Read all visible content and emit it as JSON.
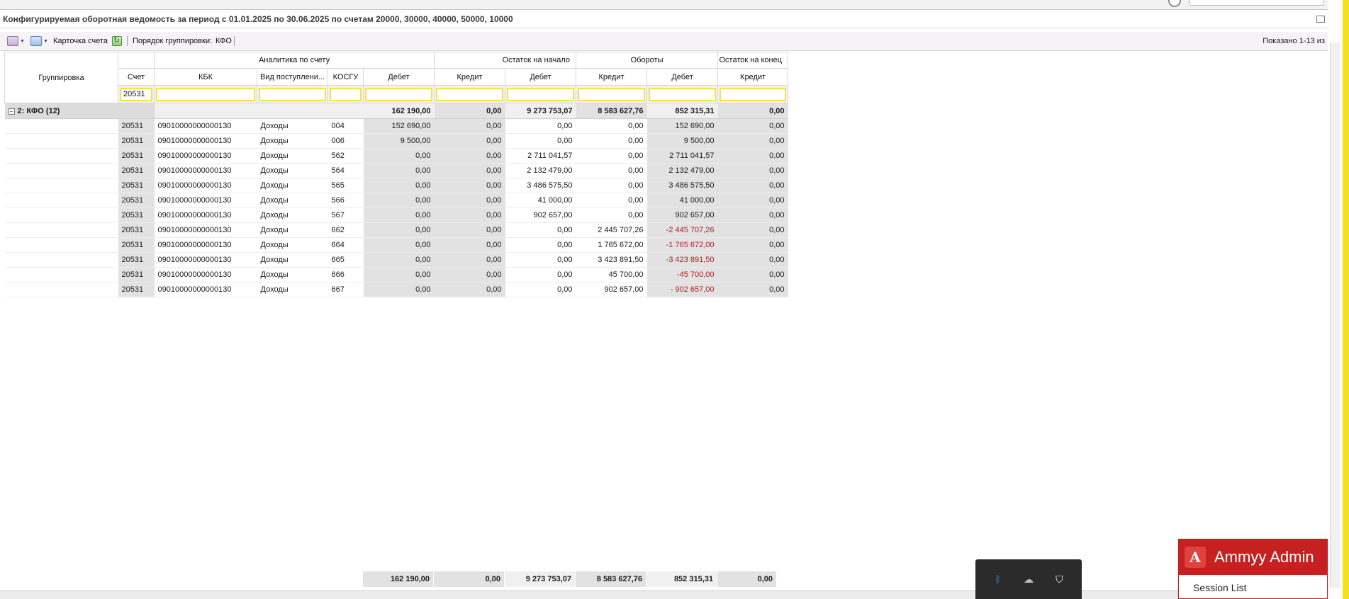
{
  "window": {
    "title": "Конфигурируемая оборотная ведомость за период с 01.01.2025 по 30.06.2025 по счетам 20000, 30000, 40000, 50000, 10000"
  },
  "toolbar": {
    "card_label": "Карточка счета",
    "grouping_order_label": "Порядок группировки:",
    "grouping_order_value": "КФО",
    "shown_text": "Показано 1-13 из"
  },
  "headers": {
    "grouping": "Группировка",
    "analytics": "Аналитика по счету",
    "opening": "Остаток на начало",
    "turnover": "Обороты",
    "closing": "Остаток на конец",
    "account": "Счет",
    "kbk": "КБК",
    "income_type": "Вид поступлени...",
    "kosgu": "КОСГУ",
    "debit": "Дебет",
    "credit": "Кредит"
  },
  "filters": {
    "account": "20531",
    "kbk": "",
    "income_type": "",
    "kosgu": "",
    "open_debit": "",
    "open_credit": "",
    "turn_debit": "",
    "turn_credit": "",
    "close_debit": "",
    "close_credit": ""
  },
  "group_row": {
    "label": "2: КФО (12)",
    "open_debit": "162 190,00",
    "open_credit": "0,00",
    "turn_debit": "9 273 753,07",
    "turn_credit": "8 583 627,76",
    "close_debit": "852 315,31",
    "close_credit": "0,00"
  },
  "rows": [
    {
      "account": "20531",
      "kbk": "09010000000000130",
      "income_type": "Доходы",
      "kosgu": "004",
      "open_debit": "152 690,00",
      "open_credit": "0,00",
      "turn_debit": "0,00",
      "turn_credit": "0,00",
      "close_debit": "152 690,00",
      "close_credit": "0,00"
    },
    {
      "account": "20531",
      "kbk": "09010000000000130",
      "income_type": "Доходы",
      "kosgu": "006",
      "open_debit": "9 500,00",
      "open_credit": "0,00",
      "turn_debit": "0,00",
      "turn_credit": "0,00",
      "close_debit": "9 500,00",
      "close_credit": "0,00"
    },
    {
      "account": "20531",
      "kbk": "09010000000000130",
      "income_type": "Доходы",
      "kosgu": "562",
      "open_debit": "0,00",
      "open_credit": "0,00",
      "turn_debit": "2 711 041,57",
      "turn_credit": "0,00",
      "close_debit": "2 711 041,57",
      "close_credit": "0,00"
    },
    {
      "account": "20531",
      "kbk": "09010000000000130",
      "income_type": "Доходы",
      "kosgu": "564",
      "open_debit": "0,00",
      "open_credit": "0,00",
      "turn_debit": "2 132 479,00",
      "turn_credit": "0,00",
      "close_debit": "2 132 479,00",
      "close_credit": "0,00"
    },
    {
      "account": "20531",
      "kbk": "09010000000000130",
      "income_type": "Доходы",
      "kosgu": "565",
      "open_debit": "0,00",
      "open_credit": "0,00",
      "turn_debit": "3 486 575,50",
      "turn_credit": "0,00",
      "close_debit": "3 486 575,50",
      "close_credit": "0,00"
    },
    {
      "account": "20531",
      "kbk": "09010000000000130",
      "income_type": "Доходы",
      "kosgu": "566",
      "open_debit": "0,00",
      "open_credit": "0,00",
      "turn_debit": "41 000,00",
      "turn_credit": "0,00",
      "close_debit": "41 000,00",
      "close_credit": "0,00"
    },
    {
      "account": "20531",
      "kbk": "09010000000000130",
      "income_type": "Доходы",
      "kosgu": "567",
      "open_debit": "0,00",
      "open_credit": "0,00",
      "turn_debit": "902 657,00",
      "turn_credit": "0,00",
      "close_debit": "902 657,00",
      "close_credit": "0,00"
    },
    {
      "account": "20531",
      "kbk": "09010000000000130",
      "income_type": "Доходы",
      "kosgu": "662",
      "open_debit": "0,00",
      "open_credit": "0,00",
      "turn_debit": "0,00",
      "turn_credit": "2 445 707,26",
      "close_debit": "-2 445 707,26",
      "close_credit": "0,00"
    },
    {
      "account": "20531",
      "kbk": "09010000000000130",
      "income_type": "Доходы",
      "kosgu": "664",
      "open_debit": "0,00",
      "open_credit": "0,00",
      "turn_debit": "0,00",
      "turn_credit": "1 765 672,00",
      "close_debit": "-1 765 672,00",
      "close_credit": "0,00"
    },
    {
      "account": "20531",
      "kbk": "09010000000000130",
      "income_type": "Доходы",
      "kosgu": "665",
      "open_debit": "0,00",
      "open_credit": "0,00",
      "turn_debit": "0,00",
      "turn_credit": "3 423 891,50",
      "close_debit": "-3 423 891,50",
      "close_credit": "0,00"
    },
    {
      "account": "20531",
      "kbk": "09010000000000130",
      "income_type": "Доходы",
      "kosgu": "666",
      "open_debit": "0,00",
      "open_credit": "0,00",
      "turn_debit": "0,00",
      "turn_credit": "45 700,00",
      "close_debit": "-45 700,00",
      "close_credit": "0,00"
    },
    {
      "account": "20531",
      "kbk": "09010000000000130",
      "income_type": "Доходы",
      "kosgu": "667",
      "open_debit": "0,00",
      "open_credit": "0,00",
      "turn_debit": "0,00",
      "turn_credit": "902 657,00",
      "close_debit": "- 902 657,00",
      "close_credit": "0,00"
    }
  ],
  "totals": {
    "open_debit": "162 190,00",
    "open_credit": "0,00",
    "turn_debit": "9 273 753,07",
    "turn_credit": "8 583 627,76",
    "close_debit": "852 315,31",
    "close_credit": "0,00"
  },
  "taskbar": {
    "icons": [
      "bluetooth-icon",
      "cloud-off-icon",
      "security-shield-icon"
    ]
  },
  "ammyy": {
    "title": "Ammyy Admin",
    "session_list": "Session List",
    "logo_letter": "A"
  },
  "colors": {
    "negative": "#b51e1e",
    "filter_border": "#f1e543",
    "ammyy_red": "#c72020"
  }
}
